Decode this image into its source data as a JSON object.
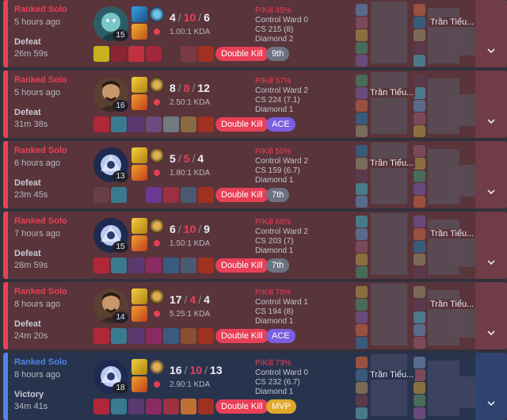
{
  "matches": [
    {
      "queue": "Ranked Solo",
      "time_ago": "5 hours ago",
      "result": "Defeat",
      "duration": "26m 59s",
      "level": "15",
      "kills": "4",
      "deaths": "10",
      "assists": "6",
      "kda": "1.00:1 KDA",
      "multikill": "Double Kill",
      "rank_badge": "9th",
      "pkill": "P/Kill 45%",
      "control_ward": "Control Ward 0",
      "cs": "CS 215 (8)",
      "tier": "Diamond 2",
      "player_name": "Trần Tiểu...",
      "champion_icon": "champion-portrait-icon"
    },
    {
      "queue": "Ranked Solo",
      "time_ago": "5 hours ago",
      "result": "Defeat",
      "duration": "31m 38s",
      "level": "16",
      "kills": "8",
      "deaths": "8",
      "assists": "12",
      "kda": "2.50:1 KDA",
      "multikill": "Double Kill",
      "rank_badge": "ACE",
      "pkill": "P/Kill 57%",
      "control_ward": "Control Ward 2",
      "cs": "CS 224 (7.1)",
      "tier": "Diamond 1",
      "player_name": "Trần Tiểu...",
      "champion_icon": "champion-portrait-icon"
    },
    {
      "queue": "Ranked Solo",
      "time_ago": "6 hours ago",
      "result": "Defeat",
      "duration": "23m 45s",
      "level": "13",
      "kills": "5",
      "deaths": "5",
      "assists": "4",
      "kda": "1.80:1 KDA",
      "multikill": "Double Kill",
      "rank_badge": "7th",
      "pkill": "P/Kill 50%",
      "control_ward": "Control Ward 2",
      "cs": "CS 159 (6.7)",
      "tier": "Diamond 1",
      "player_name": "Trần Tiểu...",
      "champion_icon": "champion-portrait-icon"
    },
    {
      "queue": "Ranked Solo",
      "time_ago": "7 hours ago",
      "result": "Defeat",
      "duration": "28m 59s",
      "level": "15",
      "kills": "6",
      "deaths": "10",
      "assists": "9",
      "kda": "1.50:1 KDA",
      "multikill": "Double Kill",
      "rank_badge": "7th",
      "pkill": "P/Kill 68%",
      "control_ward": "Control Ward 2",
      "cs": "CS 203 (7)",
      "tier": "Diamond 1",
      "player_name": "Trần Tiểu...",
      "champion_icon": "champion-portrait-icon"
    },
    {
      "queue": "Ranked Solo",
      "time_ago": "8 hours ago",
      "result": "Defeat",
      "duration": "24m 20s",
      "level": "14",
      "kills": "17",
      "deaths": "4",
      "assists": "4",
      "kda": "5.25:1 KDA",
      "multikill": "Double Kill",
      "rank_badge": "ACE",
      "pkill": "P/Kill 78%",
      "control_ward": "Control Ward 1",
      "cs": "CS 194 (8)",
      "tier": "Diamond 1",
      "player_name": "Trần Tiểu...",
      "champion_icon": "champion-portrait-icon"
    },
    {
      "queue": "Ranked Solo",
      "time_ago": "8 hours ago",
      "result": "Victory",
      "duration": "34m 41s",
      "level": "18",
      "kills": "16",
      "deaths": "10",
      "assists": "13",
      "kda": "2.90:1 KDA",
      "multikill": "Double Kill",
      "rank_badge": "MVP",
      "pkill": "P/Kill 73%",
      "control_ward": "Control Ward 0",
      "cs": "CS 232 (6.7)",
      "tier": "Diamond 1",
      "player_name": "Trần Tiểu...",
      "champion_icon": "champion-portrait-icon"
    }
  ],
  "colors": {
    "defeat_bg": "#59343b",
    "victory_bg": "#28344e",
    "defeat_accent": "#e84057",
    "victory_accent": "#5383e8",
    "ace_badge": "#7b5de0",
    "mvp_badge": "#e0a82e",
    "place_badge": "#6c7280"
  },
  "icons": {
    "expand": "chevron-down-icon",
    "spell": "summoner-spell-icon",
    "rune": "rune-icon",
    "item": "item-icon",
    "participant": "participant-champion-icon"
  }
}
